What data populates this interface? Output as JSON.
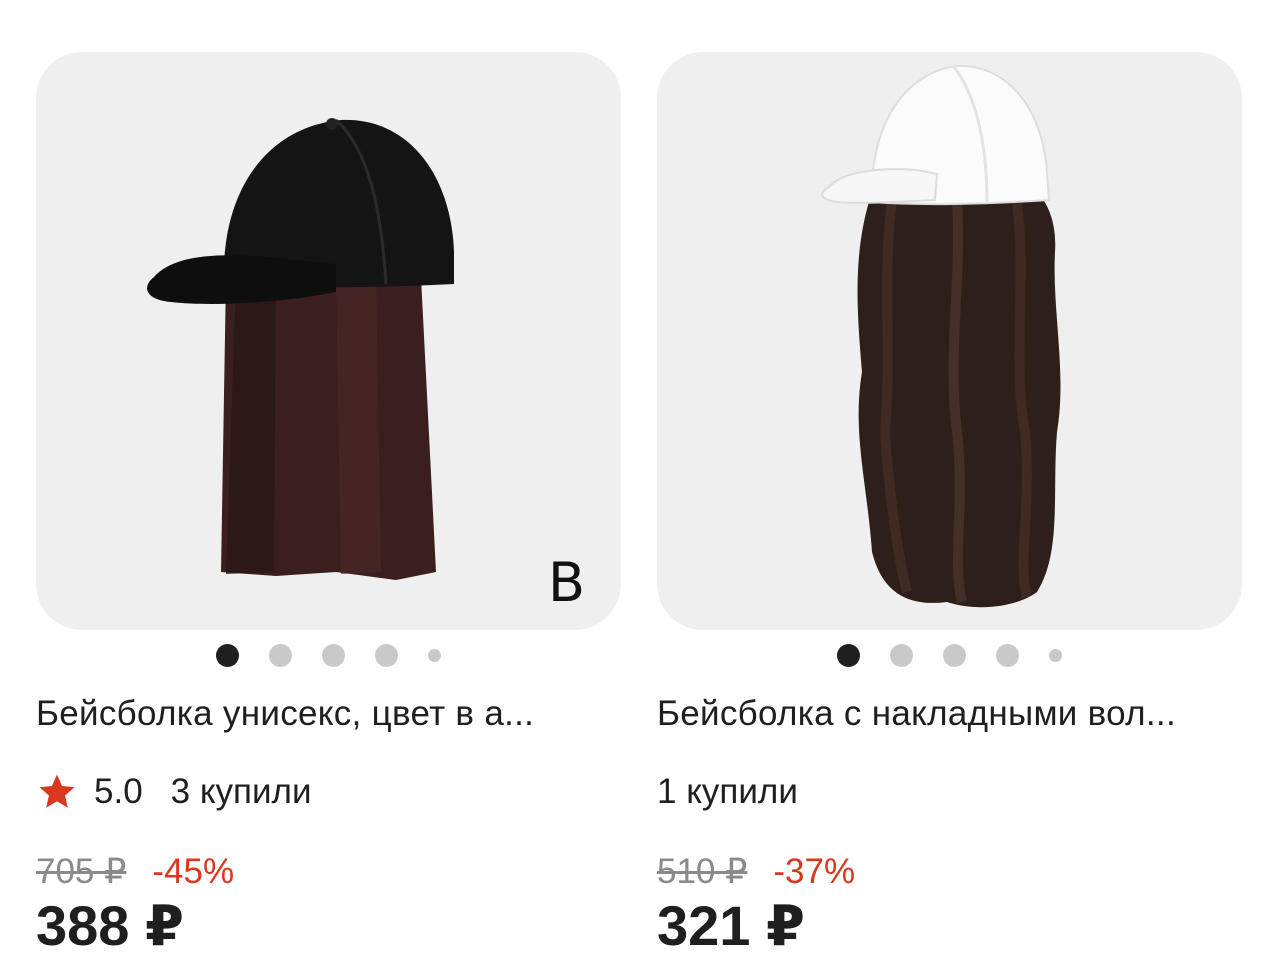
{
  "products": [
    {
      "title": "Бейсболка унисекс, цвет в а...",
      "variant_letter": "B",
      "rating": "5.0",
      "bought": "3 купили",
      "old_price": "705 ₽",
      "discount": "-45%",
      "price": "388 ₽",
      "image_dots": 5,
      "active_dot": 1
    },
    {
      "title": "Бейсболка с накладными вол...",
      "bought": "1 купили",
      "old_price": "510 ₽",
      "discount": "-37%",
      "price": "321 ₽",
      "image_dots": 5,
      "active_dot": 1
    }
  ],
  "colors": {
    "discount": "#d9381e",
    "star": "#d9381e",
    "card_bg": "#efefef"
  }
}
